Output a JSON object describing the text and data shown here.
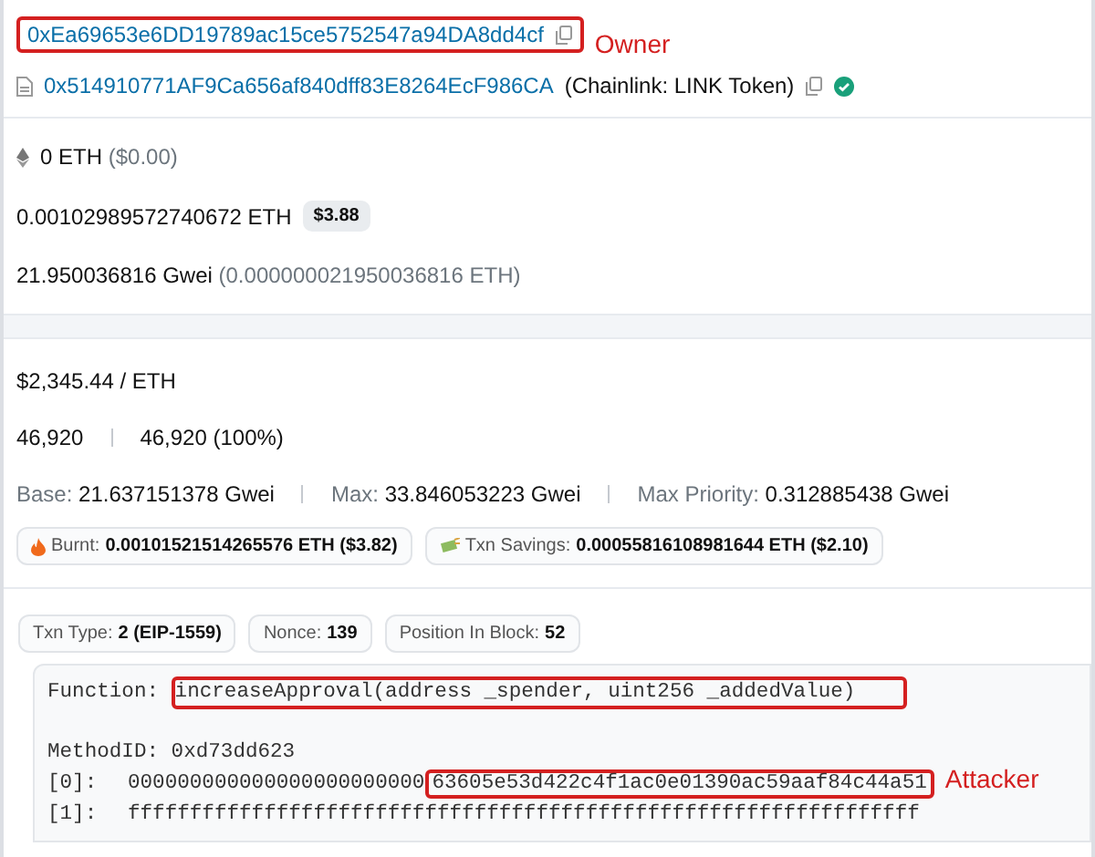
{
  "from": {
    "address": "0xEa69653e6DD19789ac15ce5752547a94DA8dd4cf",
    "annotation": "Owner"
  },
  "to": {
    "address": "0x514910771AF9Ca656af840dff83E8264EcF986CA",
    "name": "(Chainlink: LINK Token)",
    "verified": true
  },
  "value": {
    "amount": "0 ETH",
    "usd": "($0.00)"
  },
  "fee": {
    "amount": "0.00102989572740672 ETH",
    "usd": "$3.88"
  },
  "gas_price": {
    "amount": "21.950036816 Gwei",
    "eth": "(0.000000021950036816 ETH)"
  },
  "eth_price": "$2,345.44 / ETH",
  "gas": {
    "limit": "46,920",
    "used": "46,920 (100%)"
  },
  "gas_fees": [
    {
      "label": "Base:",
      "value": "21.637151378 Gwei"
    },
    {
      "label": "Max:",
      "value": "33.846053223 Gwei"
    },
    {
      "label": "Max Priority:",
      "value": "0.312885438 Gwei"
    }
  ],
  "burn": [
    {
      "kind": "fire",
      "label": "Burnt:",
      "value": "0.00101521514265576 ETH ($3.82)"
    },
    {
      "kind": "savings",
      "label": "Txn Savings:",
      "value": "0.00055816108981644 ETH ($2.10)"
    }
  ],
  "attributes": [
    {
      "label": "Txn Type:",
      "value": "2 (EIP-1559)"
    },
    {
      "label": "Nonce:",
      "value": "139"
    },
    {
      "label": "Position In Block:",
      "value": "52"
    }
  ],
  "input": {
    "function_label": "Function:",
    "function": "increaseApproval(address _spender, uint256 _addedValue)",
    "method_id": "MethodID: 0xd73dd623",
    "params": [
      {
        "label": "[0]:",
        "plain": "000000000000000000000000",
        "marked": "63605e53d422c4f1ac0e01390ac59aaf84c44a51",
        "annotation": "Attacker"
      },
      {
        "label": "[1]:",
        "plain": "ffffffffffffffffffffffffffffffffffffffffffffffffffffffffffffffff"
      }
    ]
  }
}
